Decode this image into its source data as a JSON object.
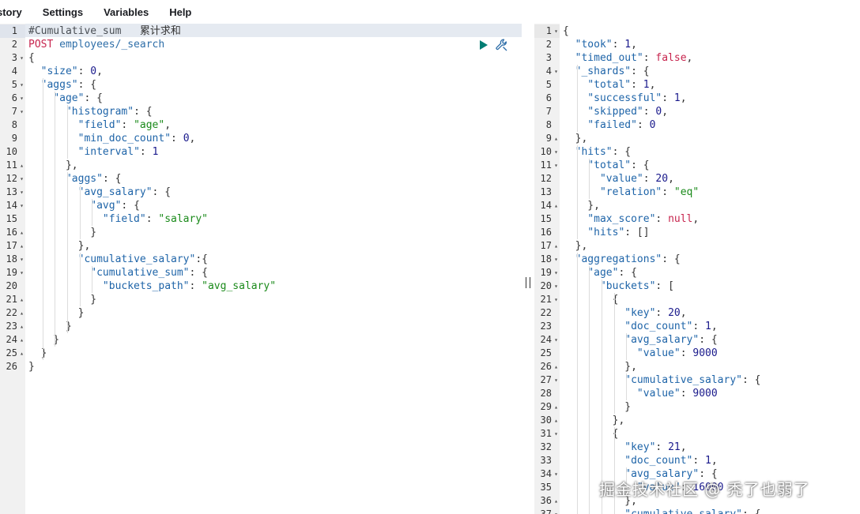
{
  "menu": [
    "story",
    "Settings",
    "Variables",
    "Help"
  ],
  "request": {
    "lines": [
      [
        [
          "c",
          "#Cumulative_sum   "
        ],
        [
          "cn",
          "累计求和"
        ]
      ],
      [
        [
          "method",
          "POST"
        ],
        [
          "p",
          " "
        ],
        [
          "url",
          "employees/_search"
        ]
      ],
      [
        [
          "p",
          "{"
        ]
      ],
      [
        [
          "p",
          "  "
        ],
        [
          "k",
          "\"size\""
        ],
        [
          "p",
          ": "
        ],
        [
          "n",
          "0"
        ],
        [
          "p",
          ","
        ]
      ],
      [
        [
          "p",
          "  "
        ],
        [
          "k",
          "\"aggs\""
        ],
        [
          "p",
          ": {"
        ]
      ],
      [
        [
          "p",
          "    "
        ],
        [
          "k",
          "\"age\""
        ],
        [
          "p",
          ": {"
        ]
      ],
      [
        [
          "p",
          "      "
        ],
        [
          "k",
          "\"histogram\""
        ],
        [
          "p",
          ": {"
        ]
      ],
      [
        [
          "p",
          "        "
        ],
        [
          "k",
          "\"field\""
        ],
        [
          "p",
          ": "
        ],
        [
          "s",
          "\"age\""
        ],
        [
          "p",
          ","
        ]
      ],
      [
        [
          "p",
          "        "
        ],
        [
          "k",
          "\"min_doc_count\""
        ],
        [
          "p",
          ": "
        ],
        [
          "n",
          "0"
        ],
        [
          "p",
          ","
        ]
      ],
      [
        [
          "p",
          "        "
        ],
        [
          "k",
          "\"interval\""
        ],
        [
          "p",
          ": "
        ],
        [
          "n",
          "1"
        ]
      ],
      [
        [
          "p",
          "      },"
        ]
      ],
      [
        [
          "p",
          "      "
        ],
        [
          "k",
          "\"aggs\""
        ],
        [
          "p",
          ": {"
        ]
      ],
      [
        [
          "p",
          "        "
        ],
        [
          "k",
          "\"avg_salary\""
        ],
        [
          "p",
          ": {"
        ]
      ],
      [
        [
          "p",
          "          "
        ],
        [
          "k",
          "\"avg\""
        ],
        [
          "p",
          ": {"
        ]
      ],
      [
        [
          "p",
          "            "
        ],
        [
          "k",
          "\"field\""
        ],
        [
          "p",
          ": "
        ],
        [
          "s",
          "\"salary\""
        ]
      ],
      [
        [
          "p",
          "          }"
        ]
      ],
      [
        [
          "p",
          "        },"
        ]
      ],
      [
        [
          "p",
          "        "
        ],
        [
          "k",
          "\"cumulative_salary\""
        ],
        [
          "p",
          ":{"
        ]
      ],
      [
        [
          "p",
          "          "
        ],
        [
          "k",
          "\"cumulative_sum\""
        ],
        [
          "p",
          ": {"
        ]
      ],
      [
        [
          "p",
          "            "
        ],
        [
          "k",
          "\"buckets_path\""
        ],
        [
          "p",
          ": "
        ],
        [
          "s",
          "\"avg_salary\""
        ]
      ],
      [
        [
          "p",
          "          }"
        ]
      ],
      [
        [
          "p",
          "        }"
        ]
      ],
      [
        [
          "p",
          "      }"
        ]
      ],
      [
        [
          "p",
          "    }"
        ]
      ],
      [
        [
          "p",
          "  }"
        ]
      ],
      [
        [
          "p",
          "}"
        ]
      ]
    ],
    "folds": [
      "",
      "",
      "open",
      "",
      "open",
      "open",
      "open",
      "",
      "",
      "",
      "close",
      "open",
      "open",
      "open",
      "",
      "close",
      "close",
      "open",
      "open",
      "",
      "close",
      "close",
      "close",
      "close",
      "close",
      ""
    ],
    "guides": [
      [
        2,
        5,
        25
      ],
      [
        4,
        6,
        24
      ],
      [
        6,
        7,
        10
      ],
      [
        6,
        12,
        23
      ],
      [
        8,
        13,
        16
      ],
      [
        10,
        14,
        15
      ],
      [
        8,
        18,
        21
      ],
      [
        10,
        19,
        20
      ]
    ]
  },
  "response": {
    "lines": [
      [
        [
          "p",
          "{"
        ]
      ],
      [
        [
          "p",
          "  "
        ],
        [
          "k",
          "\"took\""
        ],
        [
          "p",
          ": "
        ],
        [
          "n",
          "1"
        ],
        [
          "p",
          ","
        ]
      ],
      [
        [
          "p",
          "  "
        ],
        [
          "k",
          "\"timed_out\""
        ],
        [
          "p",
          ": "
        ],
        [
          "b",
          "false"
        ],
        [
          "p",
          ","
        ]
      ],
      [
        [
          "p",
          "  "
        ],
        [
          "k",
          "\"_shards\""
        ],
        [
          "p",
          ": {"
        ]
      ],
      [
        [
          "p",
          "    "
        ],
        [
          "k",
          "\"total\""
        ],
        [
          "p",
          ": "
        ],
        [
          "n",
          "1"
        ],
        [
          "p",
          ","
        ]
      ],
      [
        [
          "p",
          "    "
        ],
        [
          "k",
          "\"successful\""
        ],
        [
          "p",
          ": "
        ],
        [
          "n",
          "1"
        ],
        [
          "p",
          ","
        ]
      ],
      [
        [
          "p",
          "    "
        ],
        [
          "k",
          "\"skipped\""
        ],
        [
          "p",
          ": "
        ],
        [
          "n",
          "0"
        ],
        [
          "p",
          ","
        ]
      ],
      [
        [
          "p",
          "    "
        ],
        [
          "k",
          "\"failed\""
        ],
        [
          "p",
          ": "
        ],
        [
          "n",
          "0"
        ]
      ],
      [
        [
          "p",
          "  },"
        ]
      ],
      [
        [
          "p",
          "  "
        ],
        [
          "k",
          "\"hits\""
        ],
        [
          "p",
          ": {"
        ]
      ],
      [
        [
          "p",
          "    "
        ],
        [
          "k",
          "\"total\""
        ],
        [
          "p",
          ": {"
        ]
      ],
      [
        [
          "p",
          "      "
        ],
        [
          "k",
          "\"value\""
        ],
        [
          "p",
          ": "
        ],
        [
          "n",
          "20"
        ],
        [
          "p",
          ","
        ]
      ],
      [
        [
          "p",
          "      "
        ],
        [
          "k",
          "\"relation\""
        ],
        [
          "p",
          ": "
        ],
        [
          "s",
          "\"eq\""
        ]
      ],
      [
        [
          "p",
          "    },"
        ]
      ],
      [
        [
          "p",
          "    "
        ],
        [
          "k",
          "\"max_score\""
        ],
        [
          "p",
          ": "
        ],
        [
          "b",
          "null"
        ],
        [
          "p",
          ","
        ]
      ],
      [
        [
          "p",
          "    "
        ],
        [
          "k",
          "\"hits\""
        ],
        [
          "p",
          ": []"
        ]
      ],
      [
        [
          "p",
          "  },"
        ]
      ],
      [
        [
          "p",
          "  "
        ],
        [
          "k",
          "\"aggregations\""
        ],
        [
          "p",
          ": {"
        ]
      ],
      [
        [
          "p",
          "    "
        ],
        [
          "k",
          "\"age\""
        ],
        [
          "p",
          ": {"
        ]
      ],
      [
        [
          "p",
          "      "
        ],
        [
          "k",
          "\"buckets\""
        ],
        [
          "p",
          ": ["
        ]
      ],
      [
        [
          "p",
          "        {"
        ]
      ],
      [
        [
          "p",
          "          "
        ],
        [
          "k",
          "\"key\""
        ],
        [
          "p",
          ": "
        ],
        [
          "n",
          "20"
        ],
        [
          "p",
          ","
        ]
      ],
      [
        [
          "p",
          "          "
        ],
        [
          "k",
          "\"doc_count\""
        ],
        [
          "p",
          ": "
        ],
        [
          "n",
          "1"
        ],
        [
          "p",
          ","
        ]
      ],
      [
        [
          "p",
          "          "
        ],
        [
          "k",
          "\"avg_salary\""
        ],
        [
          "p",
          ": {"
        ]
      ],
      [
        [
          "p",
          "            "
        ],
        [
          "k",
          "\"value\""
        ],
        [
          "p",
          ": "
        ],
        [
          "n",
          "9000"
        ]
      ],
      [
        [
          "p",
          "          },"
        ]
      ],
      [
        [
          "p",
          "          "
        ],
        [
          "k",
          "\"cumulative_salary\""
        ],
        [
          "p",
          ": {"
        ]
      ],
      [
        [
          "p",
          "            "
        ],
        [
          "k",
          "\"value\""
        ],
        [
          "p",
          ": "
        ],
        [
          "n",
          "9000"
        ]
      ],
      [
        [
          "p",
          "          }"
        ]
      ],
      [
        [
          "p",
          "        },"
        ]
      ],
      [
        [
          "p",
          "        {"
        ]
      ],
      [
        [
          "p",
          "          "
        ],
        [
          "k",
          "\"key\""
        ],
        [
          "p",
          ": "
        ],
        [
          "n",
          "21"
        ],
        [
          "p",
          ","
        ]
      ],
      [
        [
          "p",
          "          "
        ],
        [
          "k",
          "\"doc_count\""
        ],
        [
          "p",
          ": "
        ],
        [
          "n",
          "1"
        ],
        [
          "p",
          ","
        ]
      ],
      [
        [
          "p",
          "          "
        ],
        [
          "k",
          "\"avg_salary\""
        ],
        [
          "p",
          ": {"
        ]
      ],
      [
        [
          "p",
          "            "
        ],
        [
          "k",
          "\"value\""
        ],
        [
          "p",
          ": "
        ],
        [
          "n",
          "16000"
        ]
      ],
      [
        [
          "p",
          "          },"
        ]
      ],
      [
        [
          "p",
          "          "
        ],
        [
          "k",
          "\"cumulative_salary\""
        ],
        [
          "p",
          ": {"
        ]
      ]
    ],
    "folds": [
      "open",
      "",
      "",
      "open",
      "",
      "",
      "",
      "",
      "close",
      "open",
      "open",
      "",
      "",
      "close",
      "",
      "",
      "close",
      "open",
      "open",
      "open",
      "open",
      "",
      "",
      "open",
      "",
      "close",
      "open",
      "",
      "close",
      "close",
      "open",
      "",
      "",
      "open",
      "",
      "close",
      "open"
    ],
    "guides": [
      [
        2,
        4,
        8
      ],
      [
        2,
        10,
        16
      ],
      [
        4,
        11,
        13
      ],
      [
        2,
        18,
        37
      ],
      [
        4,
        19,
        37
      ],
      [
        6,
        20,
        37
      ],
      [
        8,
        21,
        29
      ],
      [
        10,
        24,
        25
      ],
      [
        10,
        27,
        28
      ],
      [
        8,
        31,
        37
      ],
      [
        10,
        34,
        35
      ]
    ]
  },
  "watermark": "掘金技术社区 @ 秃了也弱了",
  "colors": {
    "run_button": "#017d73",
    "string": "#1a8a1a",
    "key": "#1e64a8",
    "literal": "#c7254e"
  }
}
